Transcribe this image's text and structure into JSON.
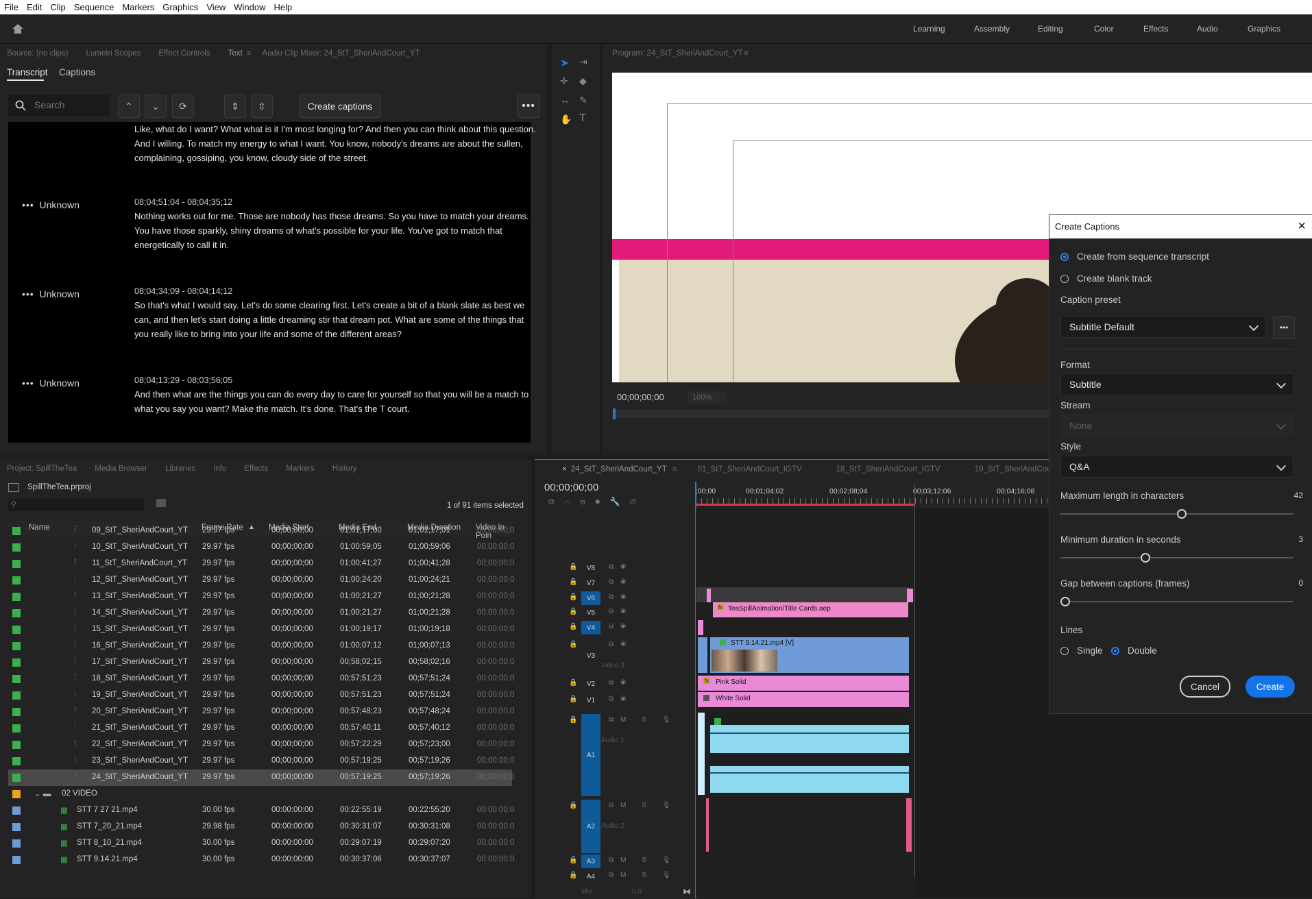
{
  "menu": [
    "File",
    "Edit",
    "Clip",
    "Sequence",
    "Markers",
    "Graphics",
    "View",
    "Window",
    "Help"
  ],
  "workspaces": [
    "Learning",
    "Assembly",
    "Editing",
    "Color",
    "Effects",
    "Audio",
    "Graphics"
  ],
  "source_tabs": [
    "Source: (no clips)",
    "Lumetri Scopes",
    "Effect Controls",
    "Text",
    "Audio Clip Mixer: 24_StT_SheriAndCourt_YT"
  ],
  "text_panel": {
    "tabs": [
      "Transcript",
      "Captions"
    ],
    "search_placeholder": "Search",
    "create_captions_label": "Create captions",
    "segments": [
      {
        "speaker": "",
        "time": "",
        "text": "Like, what do I want? What what is it I'm most longing for? And then you can think about this question. And I willing. To match my energy to what I want. You know, nobody's dreams are about the sullen, complaining, gossiping, you know, cloudy side of the street."
      },
      {
        "speaker": "Unknown",
        "time": "08;04;51;04 - 08;04;35;12",
        "text": "Nothing works out for me. Those are nobody has those dreams. So you have to match your dreams. You have those sparkly, shiny dreams of what's possible for your life. You've got to match that energetically to call it in."
      },
      {
        "speaker": "Unknown",
        "time": "08;04;34;09 - 08;04;14;12",
        "text": "So that's what I would say. Let's do some clearing first. Let's create a bit of a blank slate as best we can, and then let's start doing a little dreaming stir that dream pot. What are some of the things that you really like to bring into your life and some of the different areas?"
      },
      {
        "speaker": "Unknown",
        "time": "08;04;13;29 - 08;03;56;05",
        "text": "And then what are the things you can do every day to care for yourself so that you will be a match to what you say you want? Make the match. It's done. That's the T court."
      }
    ]
  },
  "program": {
    "title": "Program: 24_StT_SheriAndCourt_YT",
    "timecode": "00;00;00;00",
    "zoom": "100%"
  },
  "project": {
    "tabs": [
      "Project: SpillTheTea",
      "Media Browser",
      "Libraries",
      "Info",
      "Effects",
      "Markers",
      "History"
    ],
    "file": "SpillTheTea.prproj",
    "selection_info": "1 of 91 items selected",
    "columns": [
      "Name",
      "Frame Rate",
      "Media Start",
      "Media End",
      "Media Duration",
      "Video In Poin"
    ],
    "rows": [
      {
        "name": "09_StT_SheriAndCourt_YT",
        "fps": "29.97 fps",
        "start": "00;00;00;00",
        "end": "01;01;17;00",
        "dur": "01;01;17;01",
        "vin": "00;00;00;0",
        "kind": "seq"
      },
      {
        "name": "10_StT_SheriAndCourt_YT",
        "fps": "29.97 fps",
        "start": "00;00;00;00",
        "end": "01;00;59;05",
        "dur": "01;00;59;06",
        "vin": "00;00;00;0",
        "kind": "seq"
      },
      {
        "name": "11_StT_SheriAndCourt_YT",
        "fps": "29.97 fps",
        "start": "00;00;00;00",
        "end": "01;00;41;27",
        "dur": "01;00;41;28",
        "vin": "00;00;00;0",
        "kind": "seq"
      },
      {
        "name": "12_StT_SheriAndCourt_YT",
        "fps": "29.97 fps",
        "start": "00;00;00;00",
        "end": "01;00;24;20",
        "dur": "01;00;24;21",
        "vin": "00;00;00;0",
        "kind": "seq"
      },
      {
        "name": "13_StT_SheriAndCourt_YT",
        "fps": "29.97 fps",
        "start": "00;00;00;00",
        "end": "01;00;21;27",
        "dur": "01;00;21;28",
        "vin": "00;00;00;0",
        "kind": "seq"
      },
      {
        "name": "14_StT_SheriAndCourt_YT",
        "fps": "29.97 fps",
        "start": "00;00;00;00",
        "end": "01;00;21;27",
        "dur": "01;00;21;28",
        "vin": "00;00;00;0",
        "kind": "seq"
      },
      {
        "name": "15_StT_SheriAndCourt_YT",
        "fps": "29.97 fps",
        "start": "00;00;00;00",
        "end": "01;00;19;17",
        "dur": "01;00;19;18",
        "vin": "00;00;00;0",
        "kind": "seq"
      },
      {
        "name": "16_StT_SheriAndCourt_YT",
        "fps": "29.97 fps",
        "start": "00;00;00;00",
        "end": "01;00;07;12",
        "dur": "01;00;07;13",
        "vin": "00;00;00;0",
        "kind": "seq"
      },
      {
        "name": "17_StT_SheriAndCourt_YT",
        "fps": "29.97 fps",
        "start": "00;00;00;00",
        "end": "00;58;02;15",
        "dur": "00;58;02;16",
        "vin": "00;00;00;0",
        "kind": "seq"
      },
      {
        "name": "18_StT_SheriAndCourt_YT",
        "fps": "29.97 fps",
        "start": "00;00;00;00",
        "end": "00;57;51;23",
        "dur": "00;57;51;24",
        "vin": "00;00;00;0",
        "kind": "seq"
      },
      {
        "name": "19_StT_SheriAndCourt_YT",
        "fps": "29.97 fps",
        "start": "00;00;00;00",
        "end": "00;57;51;23",
        "dur": "00;57;51;24",
        "vin": "00;00;00;0",
        "kind": "seq"
      },
      {
        "name": "20_StT_SheriAndCourt_YT",
        "fps": "29.97 fps",
        "start": "00;00;00;00",
        "end": "00;57;48;23",
        "dur": "00;57;48;24",
        "vin": "00;00;00;0",
        "kind": "seq"
      },
      {
        "name": "21_StT_SheriAndCourt_YT",
        "fps": "29.97 fps",
        "start": "00;00;00;00",
        "end": "00;57;40;11",
        "dur": "00;57;40;12",
        "vin": "00;00;00;0",
        "kind": "seq"
      },
      {
        "name": "22_StT_SheriAndCourt_YT",
        "fps": "29.97 fps",
        "start": "00;00;00;00",
        "end": "00;57;22;29",
        "dur": "00;57;23;00",
        "vin": "00;00;00;0",
        "kind": "seq"
      },
      {
        "name": "23_StT_SheriAndCourt_YT",
        "fps": "29.97 fps",
        "start": "00;00;00;00",
        "end": "00;57;19;25",
        "dur": "00;57;19;26",
        "vin": "00;00;00;0",
        "kind": "seq"
      },
      {
        "name": "24_StT_SheriAndCourt_YT",
        "fps": "29.97 fps",
        "start": "00;00;00;00",
        "end": "00;57;19;25",
        "dur": "00;57;19;26",
        "vin": "00;00;00;0",
        "kind": "seq",
        "selected": true
      },
      {
        "name": "02 VIDEO",
        "fps": "",
        "start": "",
        "end": "",
        "dur": "",
        "vin": "",
        "kind": "folder"
      },
      {
        "name": "STT 7 27 21.mp4",
        "fps": "30.00 fps",
        "start": "00:00:00:00",
        "end": "00:22:55:19",
        "dur": "00:22:55:20",
        "vin": "00:00:00:0",
        "kind": "clip"
      },
      {
        "name": "STT 7_20_21.mp4",
        "fps": "29.98 fps",
        "start": "00:00:00:00",
        "end": "00:30:31:07",
        "dur": "00:30:31:08",
        "vin": "00:00:00:0",
        "kind": "clip"
      },
      {
        "name": "STT 8_10_21.mp4",
        "fps": "30.00 fps",
        "start": "00:00:00:00",
        "end": "00:29:07:19",
        "dur": "00:29:07:20",
        "vin": "00:00:00:0",
        "kind": "clip"
      },
      {
        "name": "STT 9.14.21.mp4",
        "fps": "30.00 fps",
        "start": "00:00:00:00",
        "end": "00:30:37:06",
        "dur": "00:30:37:07",
        "vin": "00:00:00:0",
        "kind": "clip"
      }
    ]
  },
  "timeline": {
    "tabs": [
      "24_StT_SheriAndCourt_YT",
      "01_StT_SheriAndCourt_IGTV",
      "18_StT_SheriAndCourt_IGTV",
      "19_StT_SheriAndCour"
    ],
    "timecode": "00;00;00;00",
    "ruler": [
      ";00;00",
      "00;01;04;02",
      "00;02;08;04",
      "00;03;12;06",
      "00;04;16;08"
    ],
    "tracks": [
      "V8",
      "V7",
      "V6",
      "V5",
      "V4",
      "V3",
      "V2",
      "V1",
      "A1",
      "A2",
      "A3",
      "A4"
    ],
    "track_names": {
      "v3": "Video 3",
      "a1": "Audio 1",
      "a2": "Audio 2"
    },
    "clips": {
      "title": "TeaSpillAnimation/Title Cards.aep",
      "video": "STT 9.14.21.mp4 [V]",
      "pink": "Pink Solid",
      "white": "White Solid"
    },
    "mix_label": "Mix",
    "mix_value": "0.0"
  },
  "dialog": {
    "title": "Create Captions",
    "radio_transcript": "Create from sequence transcript",
    "radio_blank": "Create blank track",
    "preset_label": "Caption preset",
    "preset_value": "Subtitle Default",
    "format_label": "Format",
    "format_value": "Subtitle",
    "stream_label": "Stream",
    "stream_value": "None",
    "style_label": "Style",
    "style_value": "Q&A",
    "maxlen_label": "Maximum length in characters",
    "maxlen_value": "42",
    "mindur_label": "Minimum duration in seconds",
    "mindur_value": "3",
    "gap_label": "Gap between captions (frames)",
    "gap_value": "0",
    "lines_label": "Lines",
    "lines_single": "Single",
    "lines_double": "Double",
    "cancel": "Cancel",
    "create": "Create"
  },
  "colors": {
    "accent": "#2f7ff0",
    "magenta": "#e21b7a",
    "clip_blue": "#6f9bd8",
    "clip_pink": "#e88ad8",
    "audio": "#8ed8f0"
  }
}
